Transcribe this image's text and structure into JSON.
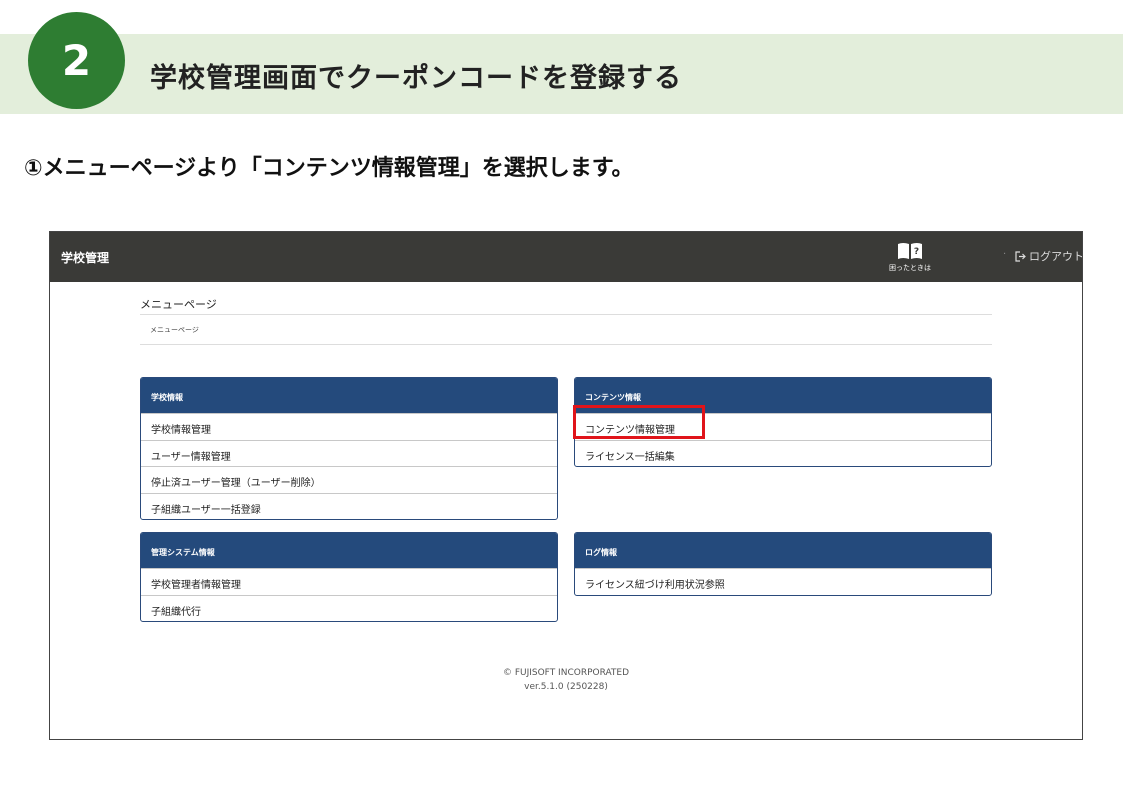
{
  "step": {
    "number": "2",
    "title": "学校管理画面でクーポンコードを登録する",
    "instruction": "①メニューページより「コンテンツ情報管理」を選択します。"
  },
  "app": {
    "header_title": "学校管理",
    "help_label": "困ったときは",
    "help_icon": "book-question-icon",
    "logout_label": "ログアウト",
    "logout_icon": "logout-icon",
    "page_heading": "メニューページ",
    "breadcrumb": "メニューページ",
    "colors": {
      "header_bg": "#3a3a37",
      "card_head_bg": "#244a7c",
      "highlight": "#e0141a",
      "step_badge": "#2e7d32",
      "step_band": "#e3eedb"
    },
    "cards": [
      {
        "title": "学校情報",
        "items": [
          "学校情報管理",
          "ユーザー情報管理",
          "停止済ユーザー管理（ユーザー削除）",
          "子組織ユーザー一括登録"
        ]
      },
      {
        "title": "コンテンツ情報",
        "items": [
          "コンテンツ情報管理",
          "ライセンス一括編集"
        ]
      },
      {
        "title": "管理システム情報",
        "items": [
          "学校管理者情報管理",
          "子組織代行"
        ]
      },
      {
        "title": "ログ情報",
        "items": [
          "ライセンス紐づけ利用状況参照"
        ]
      }
    ],
    "footer": {
      "copyright": "© FUJISOFT INCORPORATED",
      "version": "ver.5.1.0 (250228)"
    }
  }
}
